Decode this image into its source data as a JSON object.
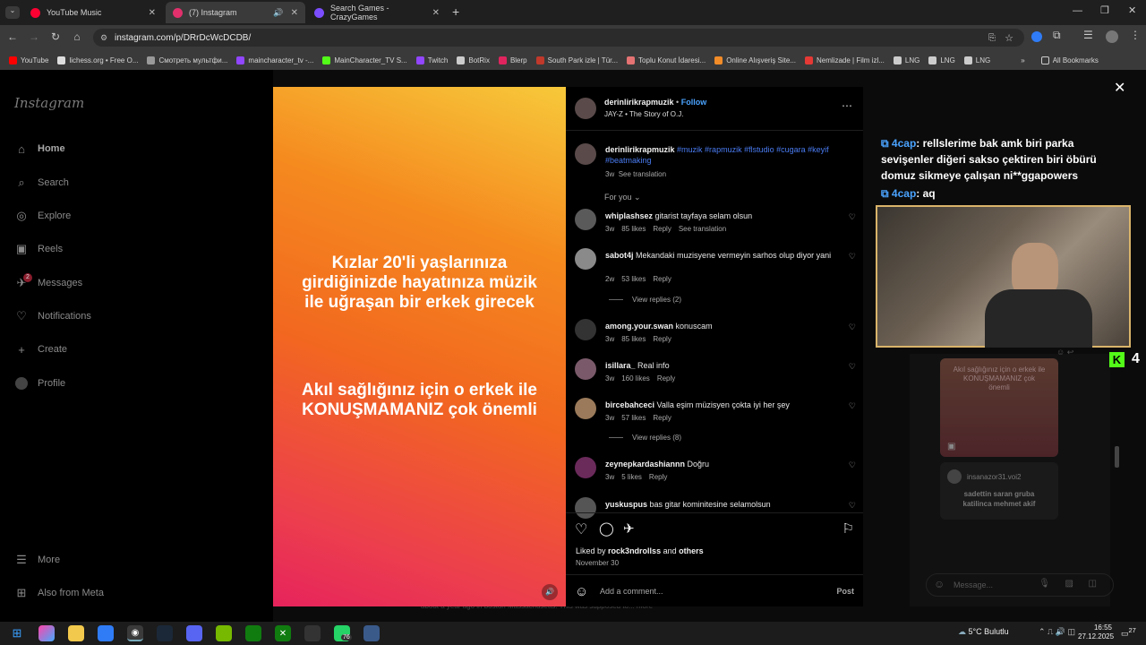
{
  "tabs": [
    {
      "title": "YouTube Music",
      "color": "#ff0033"
    },
    {
      "title": "(7) Instagram",
      "color": "#e1306c"
    },
    {
      "title": "Search Games - CrazyGames",
      "color": "#7b4dff"
    }
  ],
  "address": "instagram.com/p/DRrDcWcDCDB/",
  "bookmarks": [
    "YouTube",
    "lichess.org • Free O...",
    "Смотреть мультфи...",
    "maincharacter_tv -...",
    "MainCharacter_TV S...",
    "Twitch",
    "BotRix",
    "Blerp",
    "South Park izle | Tür...",
    "Toplu Konut İdaresi...",
    "Online Alışveriş Site...",
    "Nemlizade | Film izl...",
    "LNG",
    "LNG",
    "LNG"
  ],
  "all_bookmarks": "All Bookmarks",
  "ig": {
    "logo": "Instagram",
    "nav": [
      "Home",
      "Search",
      "Explore",
      "Reels",
      "Messages",
      "Notifications",
      "Create",
      "Profile"
    ],
    "more": "More",
    "meta": "Also from Meta",
    "messages_badge": "2"
  },
  "reel": {
    "line1": "Kızlar 20'li yaşlarınıza girdiğinizde hayatınıza müzik ile uğraşan bir erkek girecek",
    "line2": "Akıl sağlığınız için o erkek ile KONUŞMAMANIZ çok önemli"
  },
  "post": {
    "author": "derinlirikrapmuzik",
    "follow": "Follow",
    "audio": "JAY-Z • The Story of O.J.",
    "caption_tags": "#muzik #rapmuzik #flstudio #cugara #keyif #beatmaking",
    "caption_time": "3w",
    "see_translation": "See translation",
    "for_you": "For you",
    "comments": [
      {
        "user": "whiplashsez",
        "text": "gitarist tayfaya selam olsun",
        "time": "3w",
        "likes": "85 likes",
        "extra": "See translation",
        "replies": ""
      },
      {
        "user": "sabot4j",
        "text": "Mekandaki muzisyene vermeyin sarhos olup diyor yani",
        "time": "2w",
        "likes": "53 likes",
        "extra": "",
        "replies": "View replies (2)"
      },
      {
        "user": "among.your.swan",
        "text": "konuscam",
        "time": "3w",
        "likes": "85 likes",
        "extra": "",
        "replies": ""
      },
      {
        "user": "isillara_",
        "text": "Real info",
        "time": "3w",
        "likes": "160 likes",
        "extra": "",
        "replies": ""
      },
      {
        "user": "bircebahceci",
        "text": "Valla eşim müzisyen çokta iyi her şey",
        "time": "3w",
        "likes": "57 likes",
        "extra": "",
        "replies": "View replies (8)"
      },
      {
        "user": "zeynepkardashiannn",
        "text": "Doğru",
        "time": "3w",
        "likes": "5 likes",
        "extra": "",
        "replies": ""
      },
      {
        "user": "yuskuspus",
        "text": "bas gitar kominitesine selamolsun",
        "time": "",
        "likes": "",
        "extra": "",
        "replies": ""
      }
    ],
    "reply": "Reply",
    "liked_by": "Liked by",
    "liked_user": "rock3ndrollss",
    "and": "and",
    "others": "others",
    "date": "November 30",
    "add_comment": "Add a comment...",
    "post_btn": "Post"
  },
  "overlay_chat": [
    {
      "user": "4cap",
      "text": ": rellslerime bak amk biri parka sevişenler diğeri sakso çektiren biri öbürü domuz sikmeye çalışan ni**ggapowers"
    },
    {
      "user": "4cap",
      "text": ": aq"
    }
  ],
  "dm": {
    "preview_text": "Akıl sağlığınız için o erkek ile KONUŞMAMANIZ çok önemli",
    "sender": "insanazor31.voi2",
    "shared_text": "sadettin saran gruba katilinca mehmet akif",
    "placeholder": "Message...",
    "kick_num": "4"
  },
  "bg_caption": "about a year ago in boston Massachusetts. This was supposed to... more",
  "taskbar": {
    "weather": "5°C  Bulutlu",
    "time": "16:55",
    "date": "27.12.2025",
    "whatsapp_badge": "76",
    "notif": "27"
  }
}
